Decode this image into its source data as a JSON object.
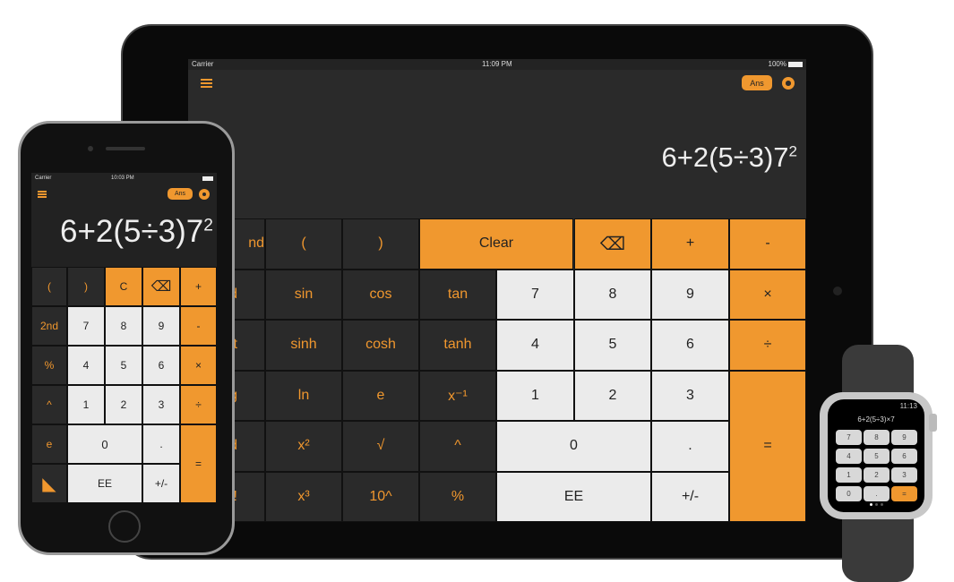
{
  "ipad": {
    "status": {
      "carrier": "Carrier",
      "time": "11:09 PM",
      "battery": "100%"
    },
    "ans_label": "Ans",
    "display": {
      "base": "6+2(5÷3)7",
      "exponent": "2"
    },
    "keys": [
      [
        "nd",
        "(",
        ")",
        "Clear",
        "⌫",
        "+",
        "-"
      ],
      [
        "d",
        "sin",
        "cos",
        "tan",
        "7",
        "8",
        "9",
        "×"
      ],
      [
        "t",
        "sinh",
        "cosh",
        "tanh",
        "4",
        "5",
        "6",
        "÷"
      ],
      [
        "g",
        "ln",
        "e",
        "x⁻¹",
        "1",
        "2",
        "3",
        "="
      ],
      [
        "od",
        "x²",
        "√",
        "^",
        "0",
        "."
      ],
      [
        "!",
        "x³",
        "10^",
        "%",
        "EE",
        "+/-"
      ]
    ]
  },
  "iphone": {
    "status": {
      "carrier": "Carrier",
      "time": "10:03 PM"
    },
    "ans_label": "Ans",
    "display": {
      "base": "6+2(5÷3)7",
      "exponent": "2"
    },
    "keys": [
      [
        "(",
        ")",
        "C",
        "⌫",
        "+"
      ],
      [
        "2nd",
        "7",
        "8",
        "9",
        "-"
      ],
      [
        "%",
        "4",
        "5",
        "6",
        "×"
      ],
      [
        "^",
        "1",
        "2",
        "3",
        "÷"
      ],
      [
        "e",
        "0",
        ".",
        "="
      ],
      [
        "◣",
        "EE",
        "+/-"
      ]
    ]
  },
  "watch": {
    "time": "11:13",
    "expression": "6+2(5÷3)×7",
    "keys": [
      "7",
      "8",
      "9",
      "4",
      "5",
      "6",
      "1",
      "2",
      "3",
      "0",
      ".",
      "="
    ]
  },
  "colors": {
    "accent": "#f0982f",
    "key_dark": "#2a2a2a",
    "key_light": "#ebebeb"
  }
}
